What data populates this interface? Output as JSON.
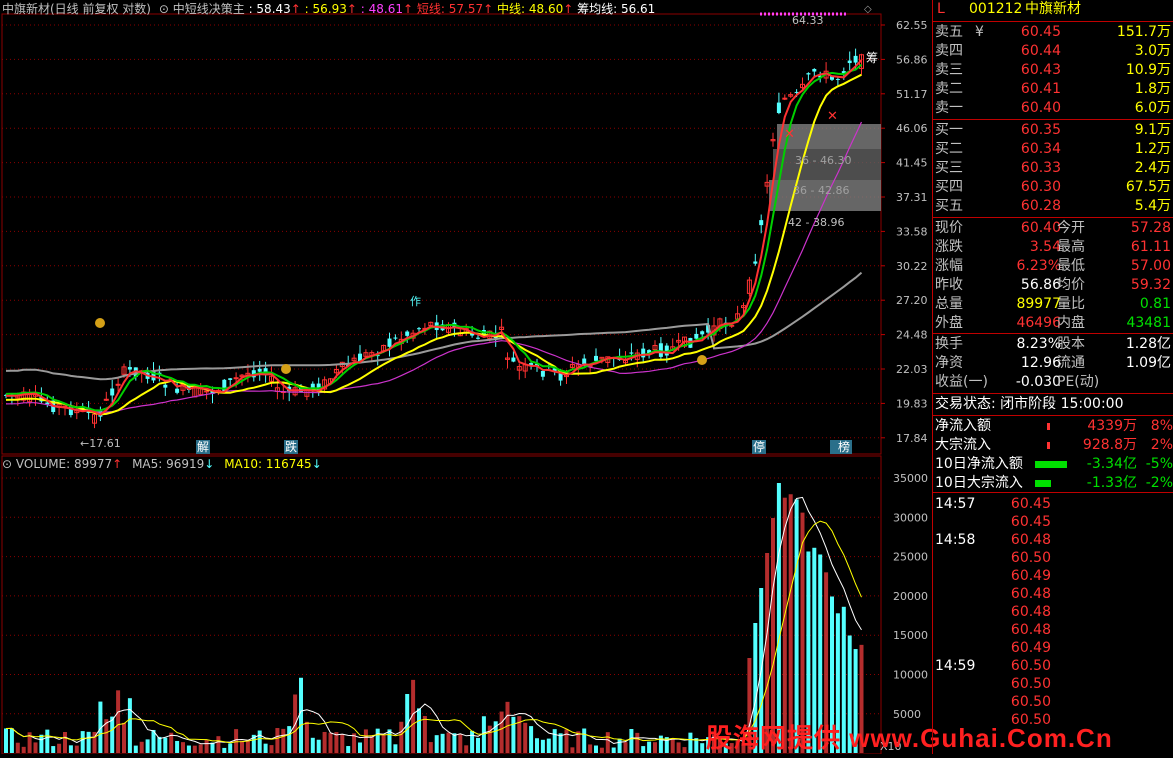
{
  "main_header": {
    "title": "中旗新材(日线 前复权 对数)",
    "indicator": "中短线决策主",
    "v1": ": 58.43",
    "v2": ": 56.93",
    "v3": ": 48.61",
    "short_label": "短线: 57.57",
    "mid_label": "中线: 48.60",
    "cost_label": "筹均线: 56.61"
  },
  "price_axis": [
    "62.55",
    "56.86",
    "51.17",
    "46.06",
    "41.45",
    "37.31",
    "33.58",
    "30.22",
    "27.20",
    "24.48",
    "22.03",
    "19.83",
    "17.84"
  ],
  "volume_axis": [
    "35000",
    "30000",
    "25000",
    "20000",
    "15000",
    "10000",
    "5000"
  ],
  "chart_annotations": {
    "high": "64.33",
    "low": "←17.61",
    "box1": "36 - 46.30",
    "box2": "36 - 42.86",
    "box3": "42 - 38.96",
    "marker_jie": "解",
    "marker_die": "跌",
    "marker_ting": "停",
    "marker_bang": "榜",
    "marker_zuo": "作",
    "marker_chou": "筹"
  },
  "volume_header": {
    "volume": "VOLUME: 89977",
    "ma5": "MA5: 96919",
    "ma10": "MA10: 116745"
  },
  "watermark": "股海网提供 www.Guhai.Com.Cn",
  "volume_unit": "X10",
  "colors": {
    "up": "#ff3232",
    "down": "#54ffff",
    "yellow": "#ffff00",
    "green": "#00d000",
    "magenta": "#cc33cc",
    "grid": "#8b0000"
  },
  "stock": {
    "flag": "L",
    "code": "001212",
    "name": "中旗新材"
  },
  "asks": [
    {
      "label": "卖五",
      "mark": "¥",
      "price": "60.45",
      "vol": "151.7万"
    },
    {
      "label": "卖四",
      "mark": "",
      "price": "60.44",
      "vol": "3.0万"
    },
    {
      "label": "卖三",
      "mark": "",
      "price": "60.43",
      "vol": "10.9万"
    },
    {
      "label": "卖二",
      "mark": "",
      "price": "60.41",
      "vol": "1.8万"
    },
    {
      "label": "卖一",
      "mark": "",
      "price": "60.40",
      "vol": "6.0万"
    }
  ],
  "bids": [
    {
      "label": "买一",
      "price": "60.35",
      "vol": "9.1万"
    },
    {
      "label": "买二",
      "price": "60.34",
      "vol": "1.2万"
    },
    {
      "label": "买三",
      "price": "60.33",
      "vol": "2.4万"
    },
    {
      "label": "买四",
      "price": "60.30",
      "vol": "67.5万"
    },
    {
      "label": "买五",
      "price": "60.28",
      "vol": "5.4万"
    }
  ],
  "stats": [
    {
      "l1": "现价",
      "v1": "60.40",
      "l2": "今开",
      "v2": "57.28",
      "c1": "#ff3232",
      "c2": "#ff3232"
    },
    {
      "l1": "涨跌",
      "v1": "3.54",
      "l2": "最高",
      "v2": "61.11",
      "c1": "#ff3232",
      "c2": "#ff3232"
    },
    {
      "l1": "涨幅",
      "v1": "6.23%",
      "l2": "最低",
      "v2": "57.00",
      "c1": "#ff3232",
      "c2": "#ff3232"
    },
    {
      "l1": "昨收",
      "v1": "56.86",
      "l2": "均价",
      "v2": "59.32",
      "c1": "#ffffff",
      "c2": "#ff3232"
    },
    {
      "l1": "总量",
      "v1": "89977",
      "l2": "量比",
      "v2": "0.81",
      "c1": "#ffff00",
      "c2": "#00e000"
    },
    {
      "l1": "外盘",
      "v1": "46496",
      "l2": "内盘",
      "v2": "43481",
      "c1": "#ff3232",
      "c2": "#00e000"
    }
  ],
  "stats2": [
    {
      "l1": "换手",
      "v1": "8.23%",
      "l2": "股本",
      "v2": "1.28亿"
    },
    {
      "l1": "净资",
      "v1": "12.96",
      "l2": "流通",
      "v2": "1.09亿"
    },
    {
      "l1": "收益(一)",
      "v1": "-0.030",
      "l2": "PE(动)",
      "v2": ""
    }
  ],
  "trade_status": "交易状态: 闭市阶段 15:00:00",
  "flows": [
    {
      "label": "净流入额",
      "value": "4339万",
      "pct": "8%",
      "color": "#ff3232"
    },
    {
      "label": "大宗流入",
      "value": "928.8万",
      "pct": "2%",
      "color": "#ff3232"
    },
    {
      "label": "10日净流入额",
      "value": "-3.34亿",
      "pct": "-5%",
      "color": "#00e000"
    },
    {
      "label": "10日大宗流入",
      "value": "-1.33亿",
      "pct": "-2%",
      "color": "#00e000"
    }
  ],
  "ticks": [
    {
      "time": "14:57",
      "price": "60.45"
    },
    {
      "time": "",
      "price": "60.45"
    },
    {
      "time": "14:58",
      "price": "60.48"
    },
    {
      "time": "",
      "price": "60.50"
    },
    {
      "time": "",
      "price": "60.49"
    },
    {
      "time": "",
      "price": "60.48"
    },
    {
      "time": "",
      "price": "60.48"
    },
    {
      "time": "",
      "price": "60.48"
    },
    {
      "time": "",
      "price": "60.49"
    },
    {
      "time": "14:59",
      "price": "60.50"
    },
    {
      "time": "",
      "price": "60.50"
    },
    {
      "time": "",
      "price": "60.50"
    },
    {
      "time": "",
      "price": "60.50"
    }
  ]
}
